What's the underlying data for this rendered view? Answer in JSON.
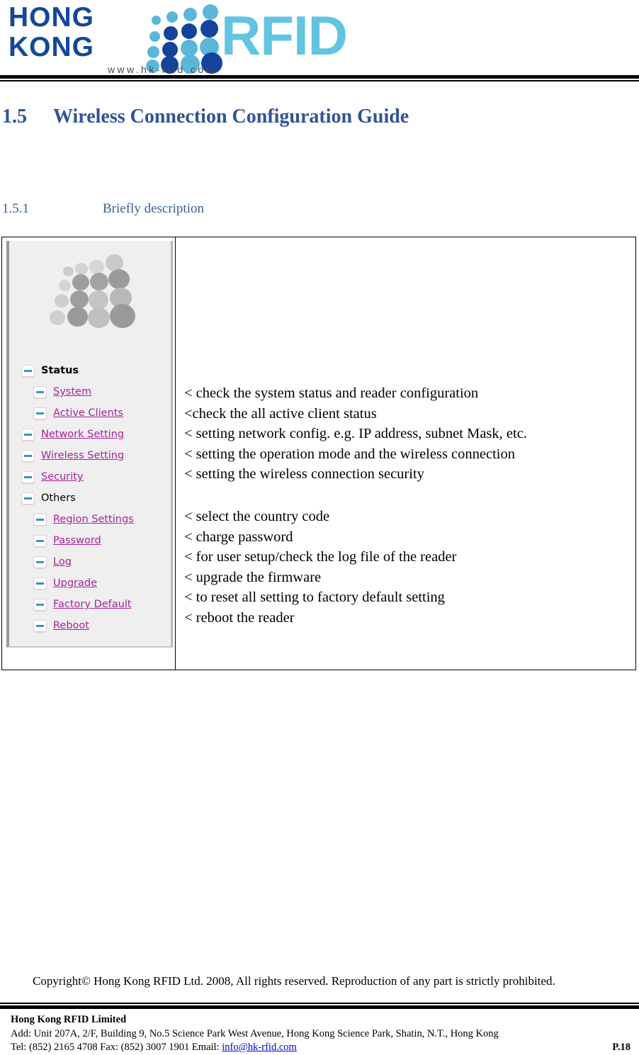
{
  "header": {
    "logo": {
      "word1": "HONG",
      "word2": "KONG",
      "brand": "RFID",
      "url": "www.hk-rfid.com",
      "colors": {
        "hongkong": "#14479A",
        "rfid": "#62C4E0",
        "dot_light": "#5BB7DA",
        "dot_dark": "#13439B",
        "url_text": "#4a4a4a"
      }
    }
  },
  "headings": {
    "section_number": "1.5",
    "section_title": "Wireless Connection Configuration Guide",
    "sub_number": "1.5.1",
    "sub_title": "Briefly description",
    "color": "#2F5496"
  },
  "figure": {
    "nav_panel": {
      "logo_icon": "rfid-dot-matrix-grayscale-icon",
      "tree": [
        {
          "label": "Status",
          "level": 1,
          "type": "plain",
          "icon": "expand-minus-icon"
        },
        {
          "label": "System",
          "level": 2,
          "type": "link",
          "icon": "expand-minus-icon"
        },
        {
          "label": "Active Clients",
          "level": 2,
          "type": "link",
          "icon": "expand-minus-icon"
        },
        {
          "label": "Network Setting",
          "level": 1,
          "type": "link",
          "icon": "expand-minus-icon"
        },
        {
          "label": "Wireless Setting",
          "level": 1,
          "type": "link",
          "icon": "expand-minus-icon"
        },
        {
          "label": "Security",
          "level": 1,
          "type": "link",
          "icon": "expand-minus-icon"
        },
        {
          "label": "Others",
          "level": 1,
          "type": "plain-thin",
          "icon": "expand-minus-icon"
        },
        {
          "label": "Region Settings",
          "level": 2,
          "type": "link",
          "icon": "expand-minus-icon"
        },
        {
          "label": "Password",
          "level": 2,
          "type": "link",
          "icon": "expand-minus-icon"
        },
        {
          "label": "Log",
          "level": 2,
          "type": "link",
          "icon": "expand-minus-icon"
        },
        {
          "label": "Upgrade",
          "level": 2,
          "type": "link",
          "icon": "expand-minus-icon"
        },
        {
          "label": "Factory Default",
          "level": 2,
          "type": "link",
          "icon": "expand-minus-icon"
        },
        {
          "label": "Reboot",
          "level": 2,
          "type": "link",
          "icon": "expand-minus-icon"
        }
      ],
      "link_color": "#A8249C",
      "minus_color": "#2E9CAE",
      "background": "#EFEFEF"
    },
    "descriptions_group1": [
      "< check the system status and reader configuration",
      "<check the all active client status",
      "< setting network config. e.g. IP address, subnet Mask, etc.",
      "< setting the operation mode and the wireless connection",
      "< setting the wireless connection security"
    ],
    "descriptions_group2": [
      "< select the country code",
      "< charge password",
      "< for user setup/check the log file of the reader",
      "< upgrade the firmware",
      "< to reset all setting to factory default setting",
      "< reboot the reader"
    ]
  },
  "footer": {
    "copyright": "Copyright© Hong Kong RFID Ltd. 2008, All rights reserved. Reproduction of any part is strictly prohibited.",
    "company": "Hong Kong RFID Limited",
    "address": "Add: Unit 207A, 2/F, Building 9, No.5 Science Park West Avenue, Hong Kong Science Park, Shatin, N.T., Hong Kong",
    "contact_prefix": "Tel: (852) 2165 4708   Fax: (852) 3007 1901   Email: ",
    "email": "info@hk-rfid.com",
    "page": "P.18"
  }
}
